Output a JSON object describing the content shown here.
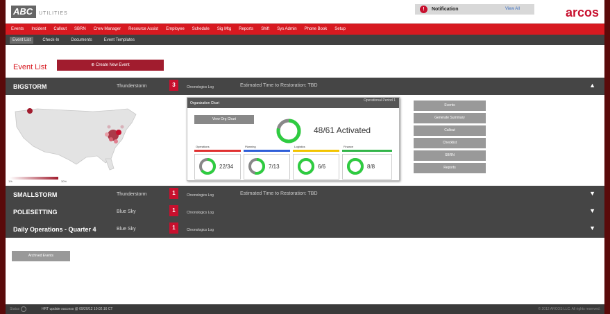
{
  "header": {
    "logo_text": "ABC",
    "logo_subtitle": "UTILITIES",
    "notification_label": "Notification",
    "notification_view": "View All",
    "brand": "arcos"
  },
  "nav": {
    "main": [
      "Events",
      "Incident",
      "Callout",
      "SBRN",
      "Crew Manager",
      "Resource Assist",
      "Employee",
      "Schedule",
      "Sig Mtg",
      "Reports",
      "Shift",
      "Sys Admin",
      "Phone Book",
      "Setup"
    ],
    "sub": [
      "Event List",
      "Check-In",
      "Documents",
      "Event Templates"
    ]
  },
  "page": {
    "title": "Event List",
    "create_button": "Create New Event"
  },
  "events": [
    {
      "name": "BIGSTORM",
      "type": "Thunderstorm",
      "count": "3",
      "log": "Chronologics Log",
      "etr": "Estimated Time to Restoration: TBD",
      "expanded": true
    },
    {
      "name": "SMALLSTORM",
      "type": "Thunderstorm",
      "count": "1",
      "log": "Chronologics Log",
      "etr": "Estimated Time to Restoration: TBD"
    },
    {
      "name": "POLESETTING",
      "type": "Blue Sky",
      "count": "1",
      "log": "Chronologics Log",
      "etr": ""
    },
    {
      "name": "Daily Operations - Quarter 4",
      "type": "Blue Sky",
      "count": "1",
      "log": "Chronologics Log",
      "etr": ""
    }
  ],
  "map": {
    "legend_min": "1%",
    "legend_max": "30%"
  },
  "org_chart": {
    "title": "Organization Chart",
    "period": "Operational Period 1",
    "view_button": "View Org Chart",
    "activated_text": "48/61 Activated",
    "activated_fraction": 0.787,
    "categories": [
      {
        "label": "Operations",
        "count": "22/34",
        "fraction": 0.647,
        "color": "#e03030"
      },
      {
        "label": "Planning",
        "count": "7/13",
        "fraction": 0.538,
        "color": "#2f5fd8"
      },
      {
        "label": "Logistics",
        "count": "6/6",
        "fraction": 1.0,
        "color": "#f2c400"
      },
      {
        "label": "Finance",
        "count": "8/8",
        "fraction": 1.0,
        "color": "#33b54a"
      }
    ]
  },
  "actions": [
    "Events",
    "Generate Summary",
    "Callout",
    "Checklist",
    "SBRN",
    "Reports"
  ],
  "archived_button": "Archived Events",
  "footer": {
    "status": "Status",
    "update": "HRT update success @ 09/20/12 10:02:16 CT",
    "copyright": "© 2012 ARCOS LLC. All rights reserved."
  },
  "colors": {
    "accent": "#d71920",
    "ring_green": "#2ecc40",
    "ring_gray": "#888888"
  }
}
